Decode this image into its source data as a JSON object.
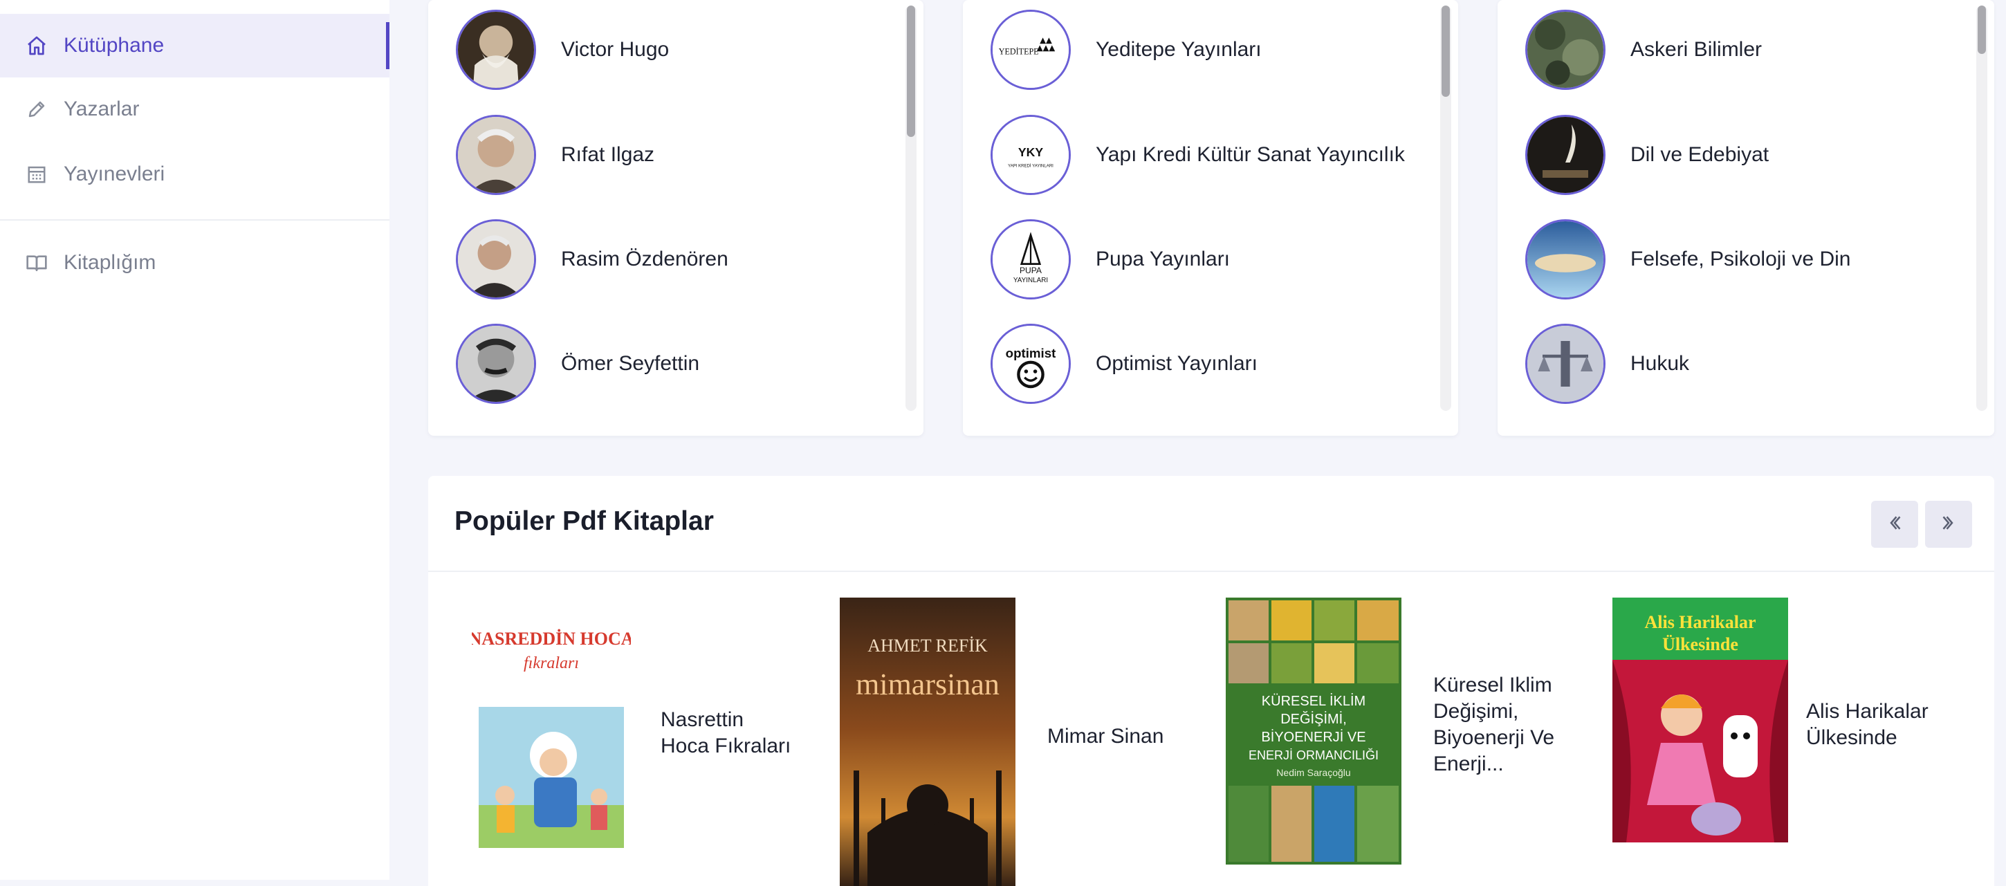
{
  "sidebar": {
    "items": [
      {
        "label": "Kütüphane",
        "icon": "home-icon",
        "active": true
      },
      {
        "label": "Yazarlar",
        "icon": "pen-icon",
        "active": false
      },
      {
        "label": "Yayınevleri",
        "icon": "building-icon",
        "active": false
      },
      {
        "label": "Kitaplığım",
        "icon": "book-open-icon",
        "active": false
      }
    ]
  },
  "authors": [
    {
      "name": "Victor Hugo"
    },
    {
      "name": "Rıfat Ilgaz"
    },
    {
      "name": "Rasim Özdenören"
    },
    {
      "name": "Ömer Seyfettin"
    }
  ],
  "publishers": [
    {
      "name": "Yeditepe Yayınları",
      "logo_text": "YEDİTEPE"
    },
    {
      "name": "Yapı Kredi Kültür Sanat Yayıncılık",
      "logo_text": "YKY",
      "logo_sub": "YAPI KREDİ YAYINLARI"
    },
    {
      "name": "Pupa Yayınları",
      "logo_text": "PUPA",
      "logo_sub": "YAYINLARI"
    },
    {
      "name": "Optimist Yayınları",
      "logo_text": "optimist"
    }
  ],
  "categories": [
    {
      "name": "Askeri Bilimler"
    },
    {
      "name": "Dil ve Edebiyat"
    },
    {
      "name": "Felsefe, Psikoloji ve Din"
    },
    {
      "name": "Hukuk"
    }
  ],
  "popular": {
    "title": "Popüler Pdf Kitaplar",
    "books": [
      {
        "title_line1": "Nasrettin",
        "title_line2": "Hoca Fıkraları",
        "cover_title": "NASREDDİN HOCA",
        "cover_sub": "fıkraları"
      },
      {
        "title_line1": "Mimar Sinan",
        "cover_author": "AHMET REFİK",
        "cover_title": "mimarsinan"
      },
      {
        "title_line1": "Küresel Iklim",
        "title_line2": "Değişimi,",
        "title_line3": "Biyoenerji Ve",
        "title_line4": "Enerji...",
        "cover_title1": "KÜRESEL İKLİM",
        "cover_title2": "DEĞİŞİMİ,",
        "cover_title3": "BİYOENERJİ VE",
        "cover_title4": "ENERJİ ORMANCILIĞI",
        "cover_author": "Nedim Saraçoğlu"
      },
      {
        "title_line1": "Alis Harikalar",
        "title_line2": "Ülkesinde",
        "cover_title1": "Alis Harikalar",
        "cover_title2": "Ülkesinde"
      }
    ]
  },
  "colors": {
    "accent": "#5346c4",
    "avatar_border": "#6a5fd6"
  }
}
